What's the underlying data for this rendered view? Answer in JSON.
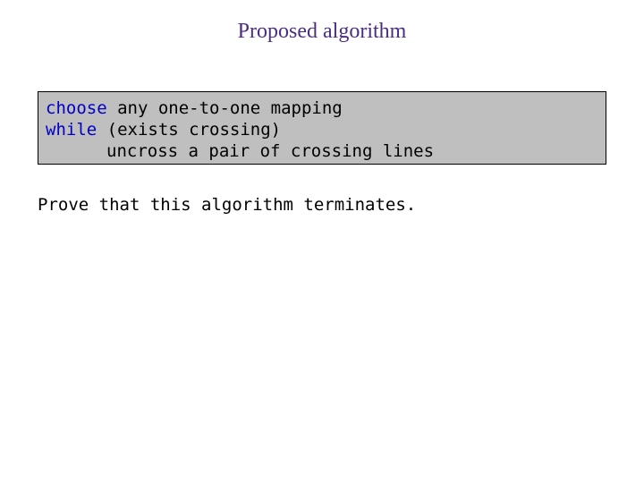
{
  "title": "Proposed algorithm",
  "code": {
    "line1_kw": "choose",
    "line1_rest": " any one-to-one mapping",
    "line2_kw": "while",
    "line2_rest": " (exists crossing)",
    "line3": "uncross a pair of crossing lines"
  },
  "prompt": "Prove that this algorithm terminates."
}
